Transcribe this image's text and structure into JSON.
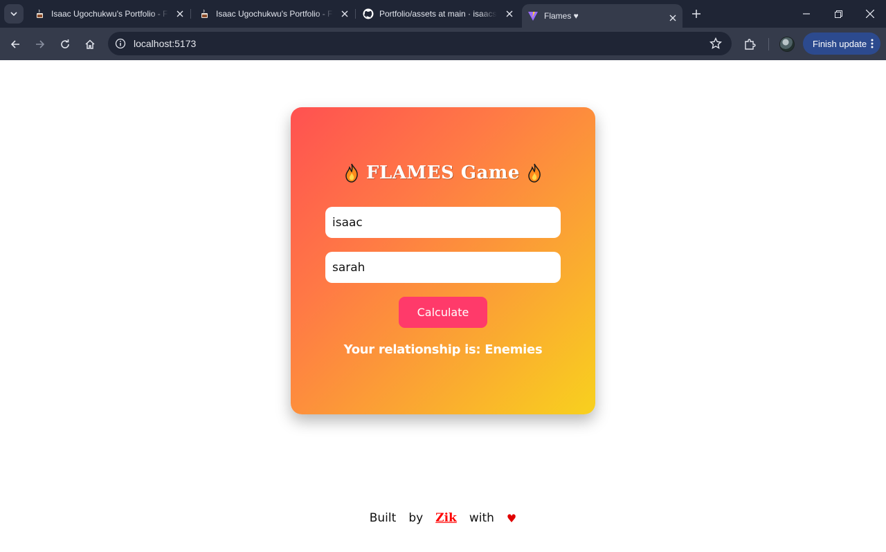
{
  "browser": {
    "tabs": [
      {
        "title": "Isaac Ugochukwu's Portfolio - F",
        "active": false
      },
      {
        "title": "Isaac Ugochukwu's Portfolio - F",
        "active": false
      },
      {
        "title": "Portfolio/assets at main · isaacs",
        "active": false
      },
      {
        "title": "Flames ♥",
        "active": true
      }
    ],
    "url": "localhost:5173",
    "finish_update_label": "Finish update"
  },
  "app": {
    "title": "FLAMES Game",
    "name1": "isaac",
    "name2": "sarah",
    "calculate_label": "Calculate",
    "result": "Your relationship is: Enemies"
  },
  "footer": {
    "built": "Built",
    "by": "by",
    "author": "Zik",
    "with": "with",
    "heart": "♥"
  },
  "colors": {
    "card_gradient_start": "#ff5151",
    "card_gradient_end": "#f8d11e",
    "button": "#ff3a6a",
    "author_link": "#ff0000"
  }
}
